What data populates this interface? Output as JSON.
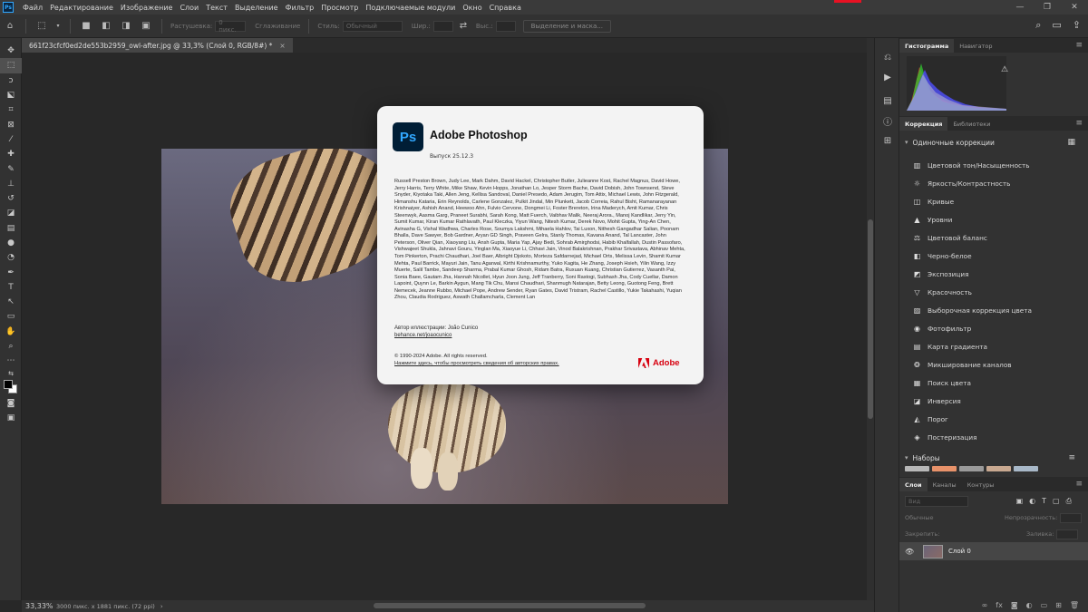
{
  "menubar": {
    "app_icon": "Ps",
    "items": [
      "Файл",
      "Редактирование",
      "Изображение",
      "Слои",
      "Текст",
      "Выделение",
      "Фильтр",
      "Просмотр",
      "Подключаемые модули",
      "Окно",
      "Справка"
    ]
  },
  "options": {
    "feather_label": "Растушевка:",
    "feather_value": "0 пикс.",
    "antialias_label": "Сглаживание",
    "style_label": "Стиль:",
    "style_value": "Обычный",
    "width_label": "Шир.:",
    "height_label": "Выс.:",
    "select_mask_button": "Выделение и маска..."
  },
  "document": {
    "tab_title": "661f23cfcf0ed2de553b2959_owl-after.jpg @ 33,3% (Слой 0, RGB/8#) *",
    "close": "×"
  },
  "status": {
    "zoom": "33,33%",
    "info": "3000 пикс. x 1881 пикс. (72 ppi)",
    "arrow": "›"
  },
  "about": {
    "icon_text": "Ps",
    "title": "Adobe Photoshop",
    "version": "Выпуск 25.12.3",
    "credits": "Russell Preston Brown, Judy Lee, Mark Dahm, David Hackel, Christopher Butler, Julieanne Kost, Rachel Magnus, David Howe, Jerry Harris, Terry White, Mike Shaw, Kevin Hopps, Jonathan Lo, Jesper Storm Bache, David Dobish, John Townsend, Steve Snyder, Kiyotaka Taki, Allen Jeng, Kellisa Sandoval, Daniel Presedo, Adam Jerugim, Tom Attix, Michael Lewis, John Fitzgerald, Himanshu Kataria, Erin Reynolds, Carlene Gonzalez, Pulkit Jindal, Min Plunkett, Jacob Correia, Rahul Bisht, Ramanarayanan Krishnaiyer, Ashish Anand, Heewoo Ahn, Fulvio Cervone, Dongmei Li, Foster Brereton, Irina Maderych, Amit Kumar, Chris Steenwyk, Aasma Garg, Praneet Surabhi, Sarah Kong, Matt Fuerch, Vaibhav Malik, Neeraj Arora., Manoj Kandlikar, Jerry Yin, Sumit Kumar, Kiran Kumar Rathlavath, Paul Kleczka, Yiyun Wang, Nitesh Kumar, Derek Novo, Mohit Gupta, Ying-An Chen, Avinasha G, Vishal Wadhwa, Charles Rose, Soumya Lakshmi, Mihaela Hahlov, Tai Luxon, Nithesh Gangadhar Salian, Poonam Bhalla, Dave Sawyer, Bob Gardner, Aryan GD Singh, Praveen Gelra, Stanly Thomas, Kavana Anand, Tal Lancaster, John Peterson, Oliver Qian, Xiaoyang Liu, Ansh Gupta, Maria Yap, Ajay Bedi, Sohrab Amirghodsi, Habib Khalfallah, Dustin Passofaro, Vishwajeet Shukla, Jahnavi Gouru, Yinglan Ma, Xiaoyue Li, Chhavi Jain, Vinod Balakrishnan, Prakhar Srivastava, Abhinav Mehta, Tom Pinkerton, Prachi Chaudhari, Joel Baer, Albright Djokoto, Morteza Safdarnejad, Michael Orts, Melissa Levin, Shamit Kumar Mehta, Paul Barrick, Mayuri Jain, Tanu Agarwal, Kirthi Krishnamurthy, Yuko Kagita, He Zhang, Joseph Hsieh, Yilin Wang, Izzy Muerte, Salil Tambe, Sandeep Sharma, Prabal Kumar Ghosh, Ridam Batra, Ruxuan Kuang, Christian Gutierrez, Vasanth Pai, Sonia Baee, Gautam Jha, Hannah Nicollet, Hyun Joon Jung, Jeff Tranberry, Soni Rastogi, Subhash Jha, Cody Cuellar, Damon Lapoint, Quynn Le, Barkin Aygun, Mang Tik Chu, Mansi Chaudhari, Shanmugh Natarajan, Betty Leong, Guotong Feng, Brett Nemecek, Jeanne Rubbo, Michael Pope, Andrew Sender, Ryan Gates, David Tristram, Rachel Castillo, Yukie Takahashi, Yuqian Zhou, Claudia Rodriguez, Aswath Challamcharla, Clement Lan",
    "illustration_by": "Автор иллюстрации: João Cunico",
    "illustration_link": "behance.net/joaocunico",
    "copyright": "© 1990-2024 Adobe. All rights reserved.",
    "legal_link": "Нажмите здесь, чтобы просмотреть сведения об авторских правах.",
    "adobe_word": "Adobe"
  },
  "panels": {
    "histogram_tabs": [
      "Гистограмма",
      "Навигатор"
    ],
    "adjust_tabs": [
      "Коррекция",
      "Библиотеки"
    ],
    "single_corrections": "Одиночные коррекции",
    "adjustments": [
      {
        "label": "Цветовой тон/Насыщенность",
        "icon": "hue-saturation-icon"
      },
      {
        "label": "Яркость/Контрастность",
        "icon": "brightness-contrast-icon"
      },
      {
        "label": "Кривые",
        "icon": "curves-icon"
      },
      {
        "label": "Уровни",
        "icon": "levels-icon"
      },
      {
        "label": "Цветовой баланс",
        "icon": "color-balance-icon"
      },
      {
        "label": "Черно-белое",
        "icon": "black-white-icon"
      },
      {
        "label": "Экспозиция",
        "icon": "exposure-icon"
      },
      {
        "label": "Красочность",
        "icon": "vibrance-icon"
      },
      {
        "label": "Выборочная коррекция цвета",
        "icon": "selective-color-icon"
      },
      {
        "label": "Фотофильтр",
        "icon": "photo-filter-icon"
      },
      {
        "label": "Карта градиента",
        "icon": "gradient-map-icon"
      },
      {
        "label": "Микширование каналов",
        "icon": "channel-mixer-icon"
      },
      {
        "label": "Поиск цвета",
        "icon": "color-lookup-icon"
      },
      {
        "label": "Инверсия",
        "icon": "invert-icon"
      },
      {
        "label": "Порог",
        "icon": "threshold-icon"
      },
      {
        "label": "Постеризация",
        "icon": "posterize-icon"
      }
    ],
    "presets": "Наборы",
    "layers_tabs": [
      "Слои",
      "Каналы",
      "Контуры"
    ],
    "layers_search": "Вид",
    "blend_mode": "Обычные",
    "opacity_label": "Непрозрачность:",
    "lock_label": "Закрепить:",
    "fill_label": "Заливка:",
    "layer_name": "Слой 0"
  }
}
